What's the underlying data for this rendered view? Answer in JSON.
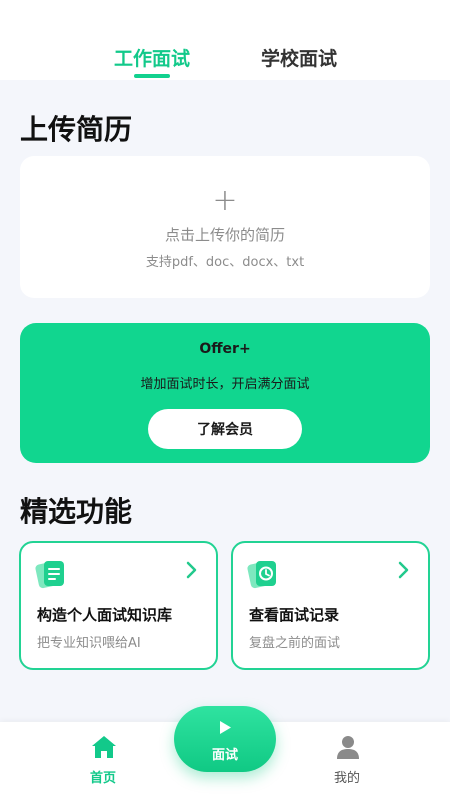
{
  "tabs": {
    "work": "工作面试",
    "school": "学校面试"
  },
  "upload": {
    "section_title": "上传简历",
    "plus": "+",
    "main_text": "点击上传你的简历",
    "formats_text": "支持pdf、doc、docx、txt"
  },
  "offer": {
    "title": "Offer+",
    "description": "增加面试时长，开启满分面试",
    "button_label": "了解会员"
  },
  "features": {
    "section_title": "精选功能",
    "items": [
      {
        "title": "构造个人面试知识库",
        "subtitle": "把专业知识喂给AI",
        "icon": "document-icon"
      },
      {
        "title": "查看面试记录",
        "subtitle": "复盘之前的面试",
        "icon": "clock-icon"
      }
    ]
  },
  "bottom_nav": {
    "home_label": "首页",
    "interview_label": "面试",
    "mine_label": "我的"
  },
  "colors": {
    "accent": "#12d18e",
    "offer_bg": "#11d68f",
    "page_bg": "#f4f6fb"
  }
}
